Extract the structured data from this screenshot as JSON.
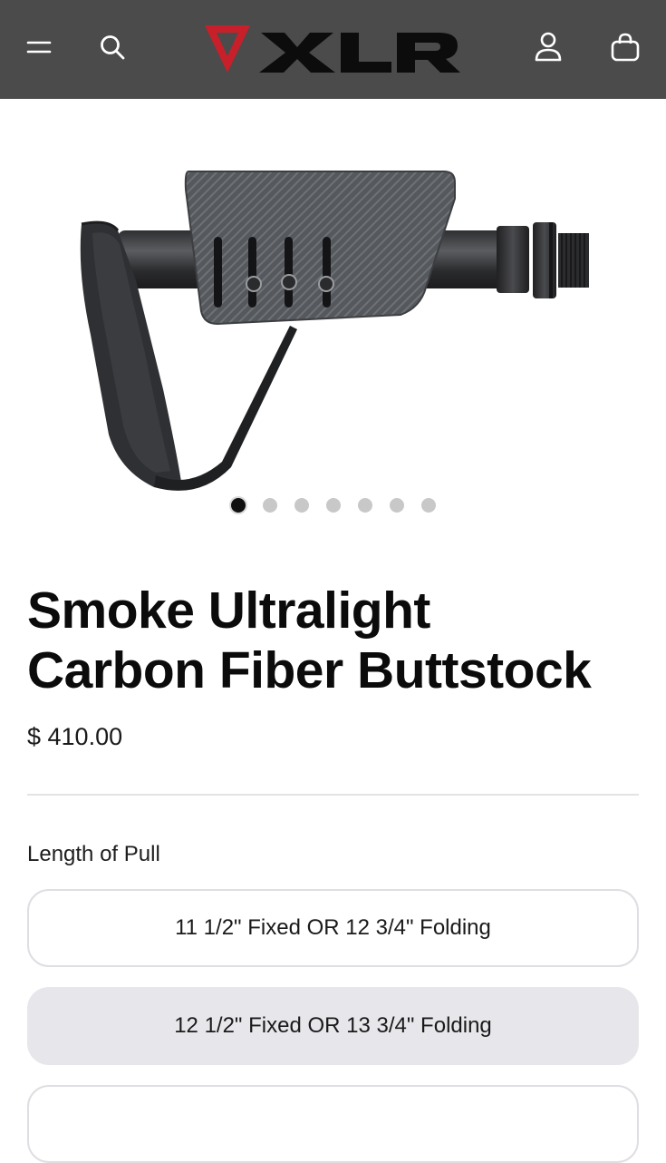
{
  "header": {
    "brand": "XLR",
    "icons": [
      "menu-icon",
      "search-icon",
      "account-icon",
      "cart-icon"
    ],
    "colors": {
      "background": "#4b4b4b",
      "logo_mark": "#c8202a",
      "logo_text": "#0c0c0c",
      "icons": "#ffffff"
    }
  },
  "gallery": {
    "image_count": 7,
    "active_index": 0
  },
  "product": {
    "title_line1": "Smoke Ultralight",
    "title_line2": "Carbon Fiber Buttstock",
    "price": "$ 410.00"
  },
  "options": {
    "label": "Length of Pull",
    "items": [
      "11 1/2\" Fixed OR 12 3/4\" Folding",
      "12 1/2\" Fixed OR 13 3/4\" Folding"
    ],
    "selected_index": 1
  }
}
